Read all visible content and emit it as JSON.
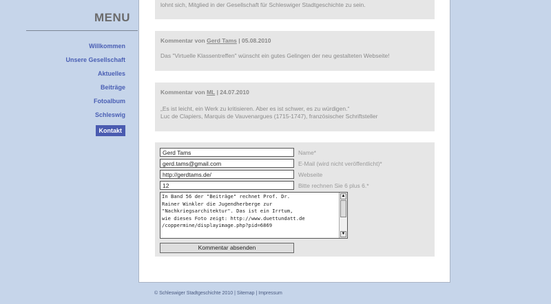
{
  "menu": {
    "title": "MENU",
    "items": [
      {
        "label": "Willkommen"
      },
      {
        "label": "Unsere Gesellschaft"
      },
      {
        "label": "Aktuelles"
      },
      {
        "label": "Beiträge"
      },
      {
        "label": "Fotoalbum"
      },
      {
        "label": "Schleswig"
      },
      {
        "label": "Kontakt"
      }
    ]
  },
  "top_box": {
    "text": "lohnt sich, Mitglied in der Gesellschaft für Schleswiger Stadtgeschichte zu sein."
  },
  "comments": [
    {
      "prefix": "Kommentar von ",
      "author": "Gerd Tams",
      "date": " | 05.08.2010",
      "body": "Das \"Virtuelle Klassentreffen\" wünscht ein gutes Gelingen der neu gestalteten Webseite!"
    },
    {
      "prefix": "Kommentar von ",
      "author": "ML",
      "date": " | 24.07.2010",
      "body_line1": "„Es ist leicht, ein Werk zu kritisieren. Aber es ist schwer, es zu würdigen.“",
      "body_line2": "Luc de Clapiers, Marquis de Vauvenargues (1715-1747), französischer Schriftsteller"
    }
  ],
  "form": {
    "name_value": "Gerd Tams",
    "name_label": "Name*",
    "email_value": "gerd.tams@gmail.com",
    "email_label": "E-Mail (wird nicht veröffentlicht)*",
    "website_value": "http://gerdtams.de/",
    "website_label": "Webseite",
    "captcha_value": "12",
    "captcha_label": "Bitte rechnen Sie 6 plus 6.*",
    "comment_text": "In Band 56 der \"Beiträge\" rechnet Prof. Dr.\nRainer Winkler die Jugendherberge zur\n\"Nachkriegsarchitektur\". Das ist ein Irrtum,\nwie dieses Foto zeigt: http://www.duettundatt.de\n/coppermine/displayimage.php?pid=6869",
    "submit_label": "Kommentar absenden"
  },
  "footer": {
    "copyright": "© Schleswiger Stadtgeschichte 2010",
    "sep1": " | ",
    "sitemap": "Sitemap",
    "sep2": " | ",
    "impressum": "Impressum"
  }
}
